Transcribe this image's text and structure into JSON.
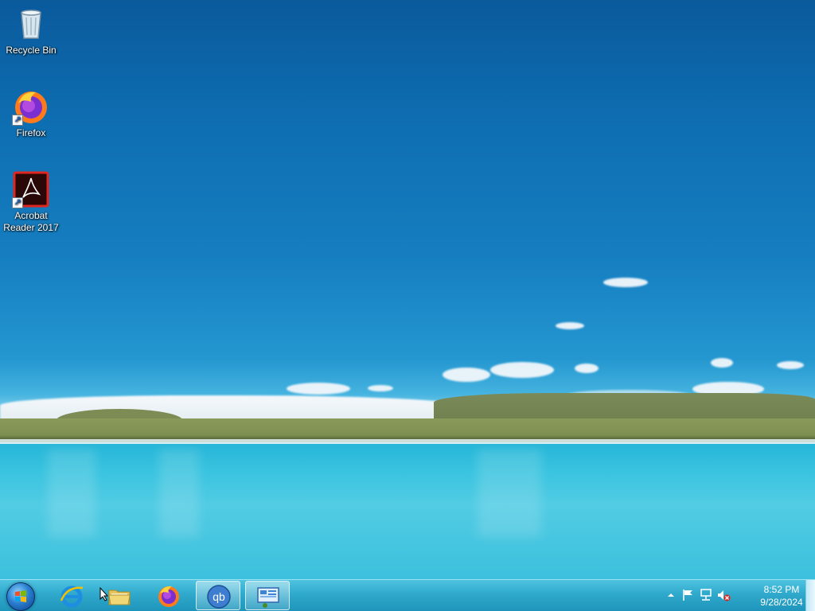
{
  "desktop": {
    "icons": [
      {
        "label": "Recycle Bin",
        "icon": "recycle-bin-icon"
      },
      {
        "label": "Firefox",
        "icon": "firefox-icon"
      },
      {
        "label": "Acrobat Reader 2017",
        "icon": "acrobat-reader-icon"
      }
    ]
  },
  "taskbar": {
    "start": {
      "icon": "windows-start-orb-icon"
    },
    "pinned": [
      {
        "name": "internet-explorer",
        "icon": "internet-explorer-icon"
      },
      {
        "name": "file-explorer",
        "icon": "folder-icon"
      },
      {
        "name": "firefox",
        "icon": "firefox-icon"
      },
      {
        "name": "qbittorrent",
        "icon": "qbittorrent-icon",
        "text": "qb"
      },
      {
        "name": "control-panel",
        "icon": "control-panel-icon"
      }
    ],
    "tray": {
      "items": [
        "show-hidden-icons-arrow",
        "action-center-flag-icon",
        "network-icon",
        "volume-muted-icon"
      ],
      "time": "8:52 PM",
      "date": "9/28/2024"
    }
  },
  "colors": {
    "sky_top": "#0a5a9c",
    "lake": "#3bc0dd",
    "taskbar": "#2fa9cc"
  }
}
